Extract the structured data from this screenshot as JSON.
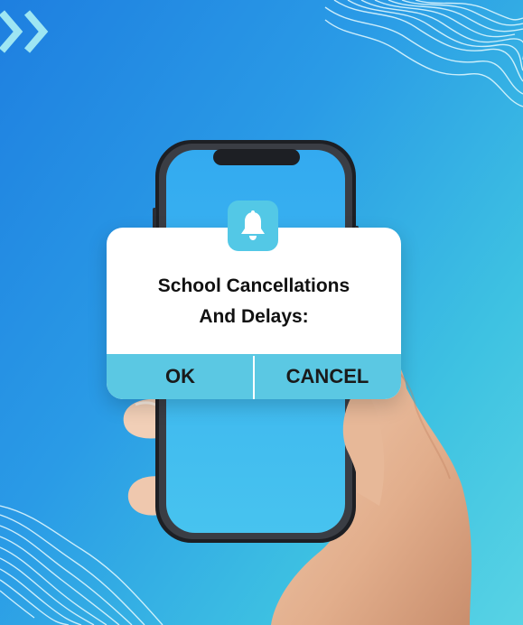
{
  "notification": {
    "icon": "bell-icon",
    "title_line1": "School Cancellations",
    "title_line2": "And Delays:",
    "ok_label": "OK",
    "cancel_label": "CANCEL"
  },
  "decor": {
    "top_left_icon": "double-chevron-right-icon"
  },
  "colors": {
    "background_start": "#1e7fe0",
    "background_end": "#58d3e4",
    "accent": "#5bc8e3",
    "card": "#ffffff",
    "text": "#111111"
  }
}
